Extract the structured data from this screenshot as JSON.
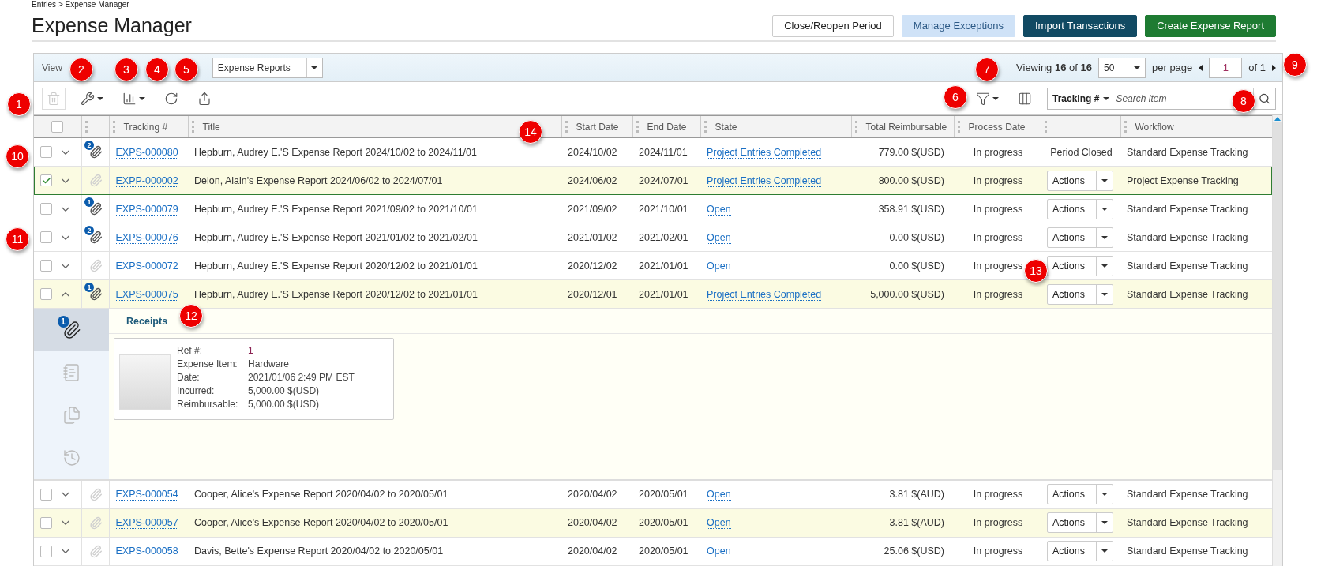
{
  "breadcrumb": "Entries > Expense Manager",
  "title": "Expense Manager",
  "header_buttons": [
    {
      "label": "Close/Reopen Period",
      "kind": "default"
    },
    {
      "label": "Manage Exceptions",
      "kind": "light"
    },
    {
      "label": "Import Transactions",
      "kind": "dark"
    },
    {
      "label": "Create Expense Report",
      "kind": "primary"
    }
  ],
  "view": {
    "label": "View",
    "value": "Expense Reports"
  },
  "pagination": {
    "summary": "Viewing **16** of **16**",
    "per_page": "50",
    "per_page_label": "per page",
    "page": "1",
    "of_pages": "of 1"
  },
  "toolbar": [
    {
      "kind": "delete",
      "disabled": true
    },
    {
      "kind": "tools",
      "disabled": false
    },
    {
      "kind": "chart",
      "disabled": false
    },
    {
      "kind": "refresh",
      "disabled": false
    },
    {
      "kind": "export",
      "disabled": false
    }
  ],
  "search": {
    "field": "Tracking #",
    "placeholder": "Search item"
  },
  "table": {
    "all_checked": false,
    "columns": [
      "Tracking #",
      "Title",
      "Start Date",
      "End Date",
      "State",
      "Total Reimbursable",
      "Process Date",
      "Workflow"
    ],
    "rows": [
      {
        "checked": false,
        "expanded": false,
        "highlighted": false,
        "attachments": {
          "count": "2",
          "active": true
        },
        "tracking": "EXPS-000080",
        "title": "Hepburn, Audrey E.'S Expense Report 2024/10/02 to 2024/11/01",
        "start": "2024/10/02",
        "end": "2024/11/01",
        "state": "Project Entries Completed",
        "total": "779.00 $(USD)",
        "process": "In progress",
        "action": {
          "kind": "text",
          "label": "Period Closed"
        },
        "workflow": "Standard Expense Tracking"
      },
      {
        "checked": true,
        "expanded": false,
        "highlighted": true,
        "attachments": {
          "active": false
        },
        "tracking": "EXPP-000002",
        "title": "Delon, Alain's Expense Report 2024/06/02 to 2024/07/01",
        "start": "2024/06/02",
        "end": "2024/07/01",
        "state": "Project Entries Completed",
        "total": "800.00 $(USD)",
        "process": "In progress",
        "action": {
          "kind": "dropdown",
          "label": "Actions"
        },
        "workflow": "Project Expense Tracking"
      },
      {
        "checked": false,
        "expanded": false,
        "highlighted": false,
        "attachments": {
          "count": "1",
          "active": true
        },
        "tracking": "EXPS-000079",
        "title": "Hepburn, Audrey E.'S Expense Report 2021/09/02 to 2021/10/01",
        "start": "2021/09/02",
        "end": "2021/10/01",
        "state": "Open",
        "total": "358.91 $(USD)",
        "process": "In progress",
        "action": {
          "kind": "dropdown",
          "label": "Actions"
        },
        "workflow": "Standard Expense Tracking"
      },
      {
        "checked": false,
        "expanded": false,
        "highlighted": false,
        "attachments": {
          "count": "2",
          "active": true
        },
        "tracking": "EXPS-000076",
        "title": "Hepburn, Audrey E.'S Expense Report 2021/01/02 to 2021/02/01",
        "start": "2021/01/02",
        "end": "2021/02/01",
        "state": "Open",
        "total": "0.00 $(USD)",
        "process": "In progress",
        "action": {
          "kind": "dropdown",
          "label": "Actions"
        },
        "workflow": "Standard Expense Tracking"
      },
      {
        "checked": false,
        "expanded": false,
        "highlighted": false,
        "attachments": {
          "active": false
        },
        "tracking": "EXPS-000072",
        "title": "Hepburn, Audrey E.'S Expense Report 2020/12/02 to 2021/01/01",
        "start": "2020/12/02",
        "end": "2021/01/01",
        "state": "Open",
        "total": "0.00 $(USD)",
        "process": "In progress",
        "action": {
          "kind": "dropdown",
          "label": "Actions"
        },
        "workflow": "Standard Expense Tracking"
      },
      {
        "checked": false,
        "expanded": true,
        "highlighted": true,
        "attachments": {
          "count": "1",
          "active": true
        },
        "tracking": "EXPS-000075",
        "title": "Hepburn, Audrey E.'S Expense Report 2020/12/02 to 2021/01/01",
        "start": "2020/12/01",
        "end": "2021/01/01",
        "state": "Project Entries Completed",
        "total": "5,000.00 $(USD)",
        "process": "In progress",
        "action": {
          "kind": "dropdown",
          "label": "Actions"
        },
        "workflow": "Standard Expense Tracking",
        "detail": {
          "tabs": [
            {
              "kind": "attachments",
              "badge": "1",
              "selected": true
            },
            {
              "kind": "notes",
              "selected": false
            },
            {
              "kind": "documents",
              "selected": false
            },
            {
              "kind": "history",
              "selected": false
            }
          ],
          "heading": "Receipts",
          "receipt": [
            {
              "label": "Ref #:",
              "value": "1",
              "kind": "ref"
            },
            {
              "label": "Expense Item:",
              "value": "Hardware",
              "kind": "plain"
            },
            {
              "label": "Date:",
              "value": "2021/01/06 2:49 PM EST",
              "kind": "plain"
            },
            {
              "label": "Incurred:",
              "value": "5,000.00 $(USD)",
              "kind": "plain"
            },
            {
              "label": "Reimbursable:",
              "value": "5,000.00 $(USD)",
              "kind": "plain"
            }
          ]
        }
      },
      {
        "checked": false,
        "expanded": false,
        "highlighted": false,
        "attachments": {
          "active": false
        },
        "tracking": "EXPS-000054",
        "title": "Cooper, Alice's Expense Report 2020/04/02 to 2020/05/01",
        "start": "2020/04/02",
        "end": "2020/05/01",
        "state": "Open",
        "total": "3.81 $(AUD)",
        "process": "In progress",
        "action": {
          "kind": "dropdown",
          "label": "Actions"
        },
        "workflow": "Standard Expense Tracking"
      },
      {
        "checked": false,
        "expanded": false,
        "highlighted": true,
        "attachments": {
          "active": false
        },
        "tracking": "EXPS-000057",
        "title": "Cooper, Alice's Expense Report 2020/04/02 to 2020/05/01",
        "start": "2020/04/02",
        "end": "2020/05/01",
        "state": "Open",
        "total": "3.81 $(AUD)",
        "process": "In progress",
        "action": {
          "kind": "dropdown",
          "label": "Actions"
        },
        "workflow": "Standard Expense Tracking"
      },
      {
        "checked": false,
        "expanded": false,
        "highlighted": false,
        "attachments": {
          "active": false
        },
        "tracking": "EXPS-000058",
        "title": "Davis, Bette's Expense Report 2020/04/02 to 2020/05/01",
        "start": "2020/04/02",
        "end": "2020/05/01",
        "state": "Open",
        "total": "25.06 $(USD)",
        "process": "In progress",
        "action": {
          "kind": "dropdown",
          "label": "Actions"
        },
        "workflow": "Standard Expense Tracking"
      }
    ]
  },
  "callouts": [
    "1",
    "2",
    "3",
    "4",
    "5",
    "6",
    "7",
    "8",
    "9",
    "10",
    "11",
    "12",
    "13",
    "14"
  ]
}
